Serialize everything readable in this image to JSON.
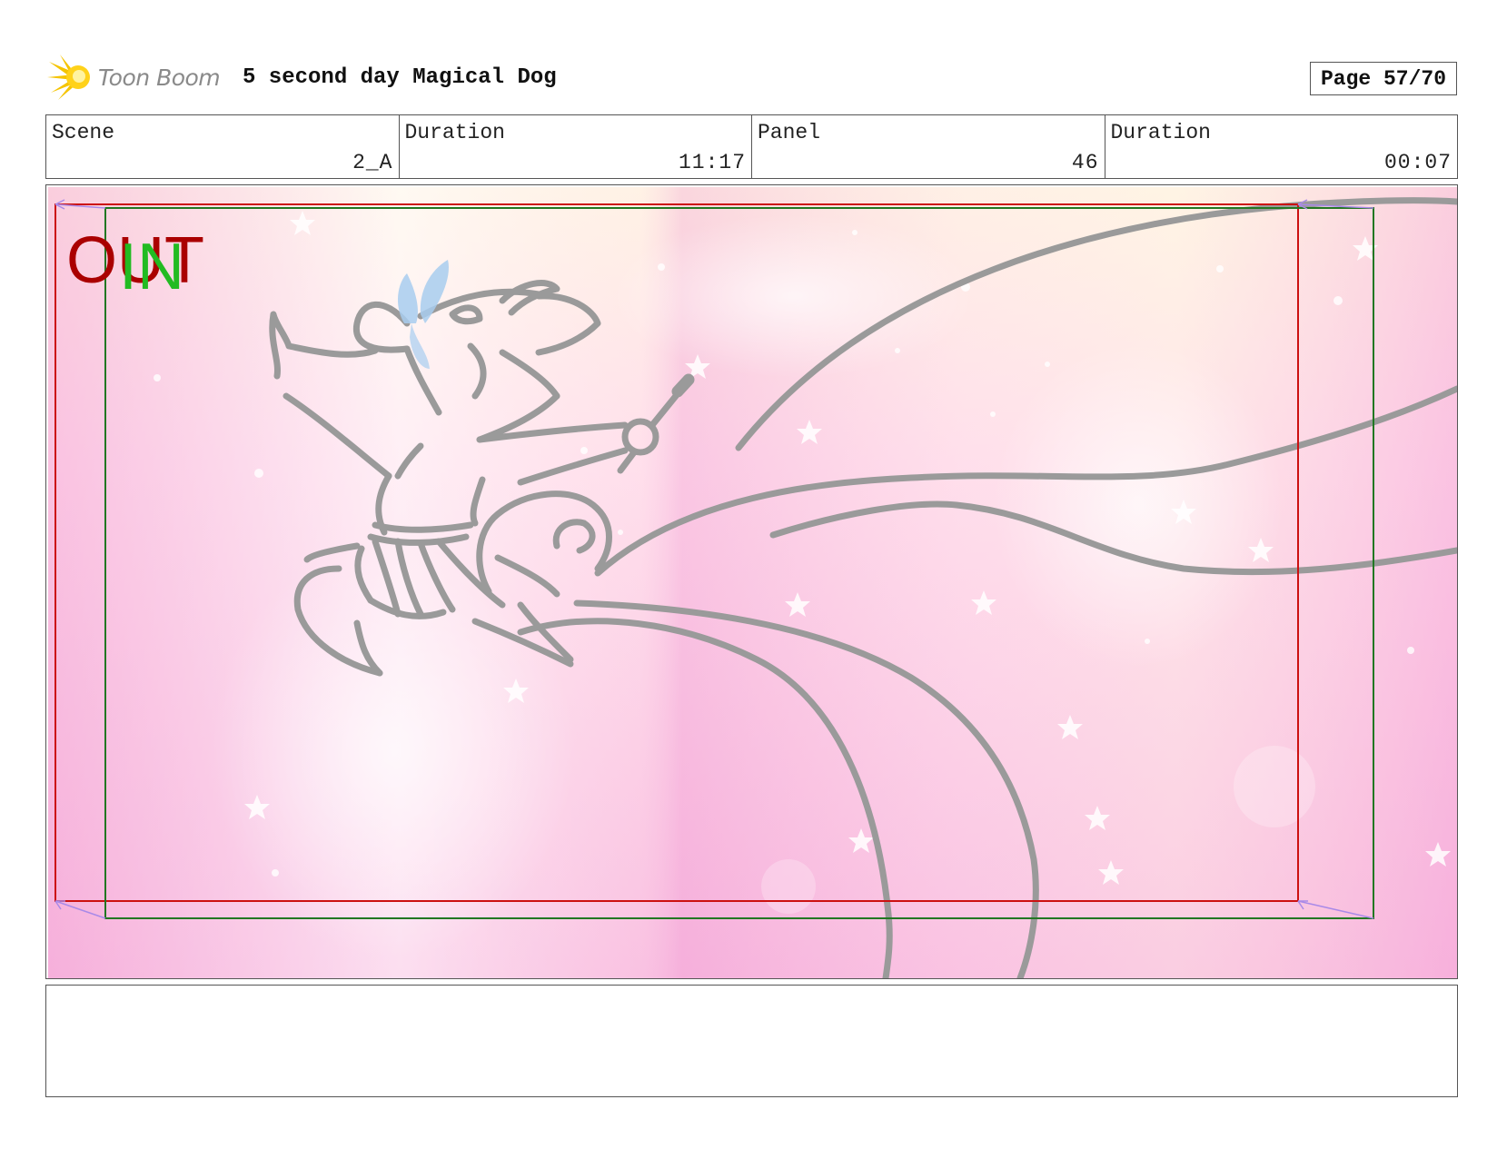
{
  "header": {
    "logo_text": "Toon Boom",
    "title": "5 second day Magical Dog",
    "page_label": "Page 57/70"
  },
  "info": [
    {
      "label": "Scene",
      "value": "2_A"
    },
    {
      "label": "Duration",
      "value": "11:17"
    },
    {
      "label": "Panel",
      "value": "46"
    },
    {
      "label": "Duration",
      "value": "00:07"
    }
  ],
  "panel": {
    "out_label": "OUT",
    "in_label": "IN",
    "colors": {
      "out_frame": "#cc1111",
      "in_frame": "#227722",
      "sketch": "#9a9a9a",
      "accent_blue": "#a8cdef"
    }
  },
  "notes": ""
}
